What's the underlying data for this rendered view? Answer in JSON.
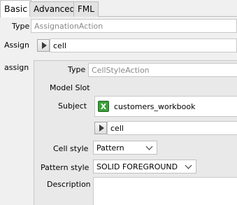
{
  "tabs": [
    {
      "label": "Basic"
    },
    {
      "label": "Advanced"
    },
    {
      "label": "FML"
    }
  ],
  "type_row": {
    "label": "Type",
    "value": "AssignationAction"
  },
  "assign_row": {
    "label": "Assign",
    "value": "cell"
  },
  "assign_section": {
    "label": "assign",
    "type": {
      "label": "Type",
      "value": "CellStyleAction"
    },
    "model_slot": {
      "label": "Model Slot"
    },
    "subject": {
      "label": "Subject",
      "icon": "excel-workbook-icon",
      "icon_glyph": "X",
      "value": "customers_workbook"
    },
    "subject_cell": {
      "value": "cell"
    },
    "cell_style": {
      "label": "Cell style",
      "selected": "Pattern"
    },
    "pattern_style": {
      "label": "Pattern style",
      "selected": "SOLID FOREGROUND"
    },
    "description": {
      "label": "Description",
      "value": ""
    }
  }
}
